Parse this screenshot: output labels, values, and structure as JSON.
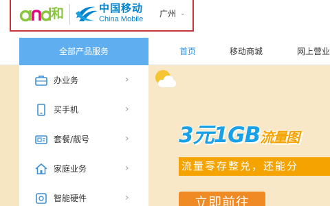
{
  "brand": {
    "he_logo_text": "和",
    "cm_name_cn": "中国移动",
    "cm_name_en": "China Mobile",
    "city": "广州",
    "colors": {
      "he_green": "#8cc63f",
      "he_pink": "#e4007f",
      "cm_blue": "#0085d0",
      "highlight_red": "#c8323a"
    }
  },
  "nav": {
    "all_products": "全部产品服务",
    "links": [
      {
        "label": "首页",
        "active": true
      },
      {
        "label": "移动商城",
        "active": false
      },
      {
        "label": "网上营业",
        "active": false
      }
    ],
    "colors": {
      "sidebar_header": "#5eaef0",
      "active_link": "#2e90e4"
    }
  },
  "sidebar": {
    "items": [
      {
        "label": "办业务",
        "icon": "briefcase-icon"
      },
      {
        "label": "买手机",
        "icon": "phone-icon"
      },
      {
        "label": "套餐/靓号",
        "icon": "sim-card-icon"
      },
      {
        "label": "家庭业务",
        "icon": "home-icon"
      },
      {
        "label": "智能硬件",
        "icon": "smart-device-icon"
      }
    ]
  },
  "banner": {
    "title_main": "3元1GB",
    "title_accent": "流量图",
    "subtitle": "流量零存整兑，还能分",
    "cta": "立即前往",
    "colors": {
      "title_blue": "#1aa0e6",
      "orange": "#f5a300",
      "background": "#f8e8c8"
    }
  }
}
